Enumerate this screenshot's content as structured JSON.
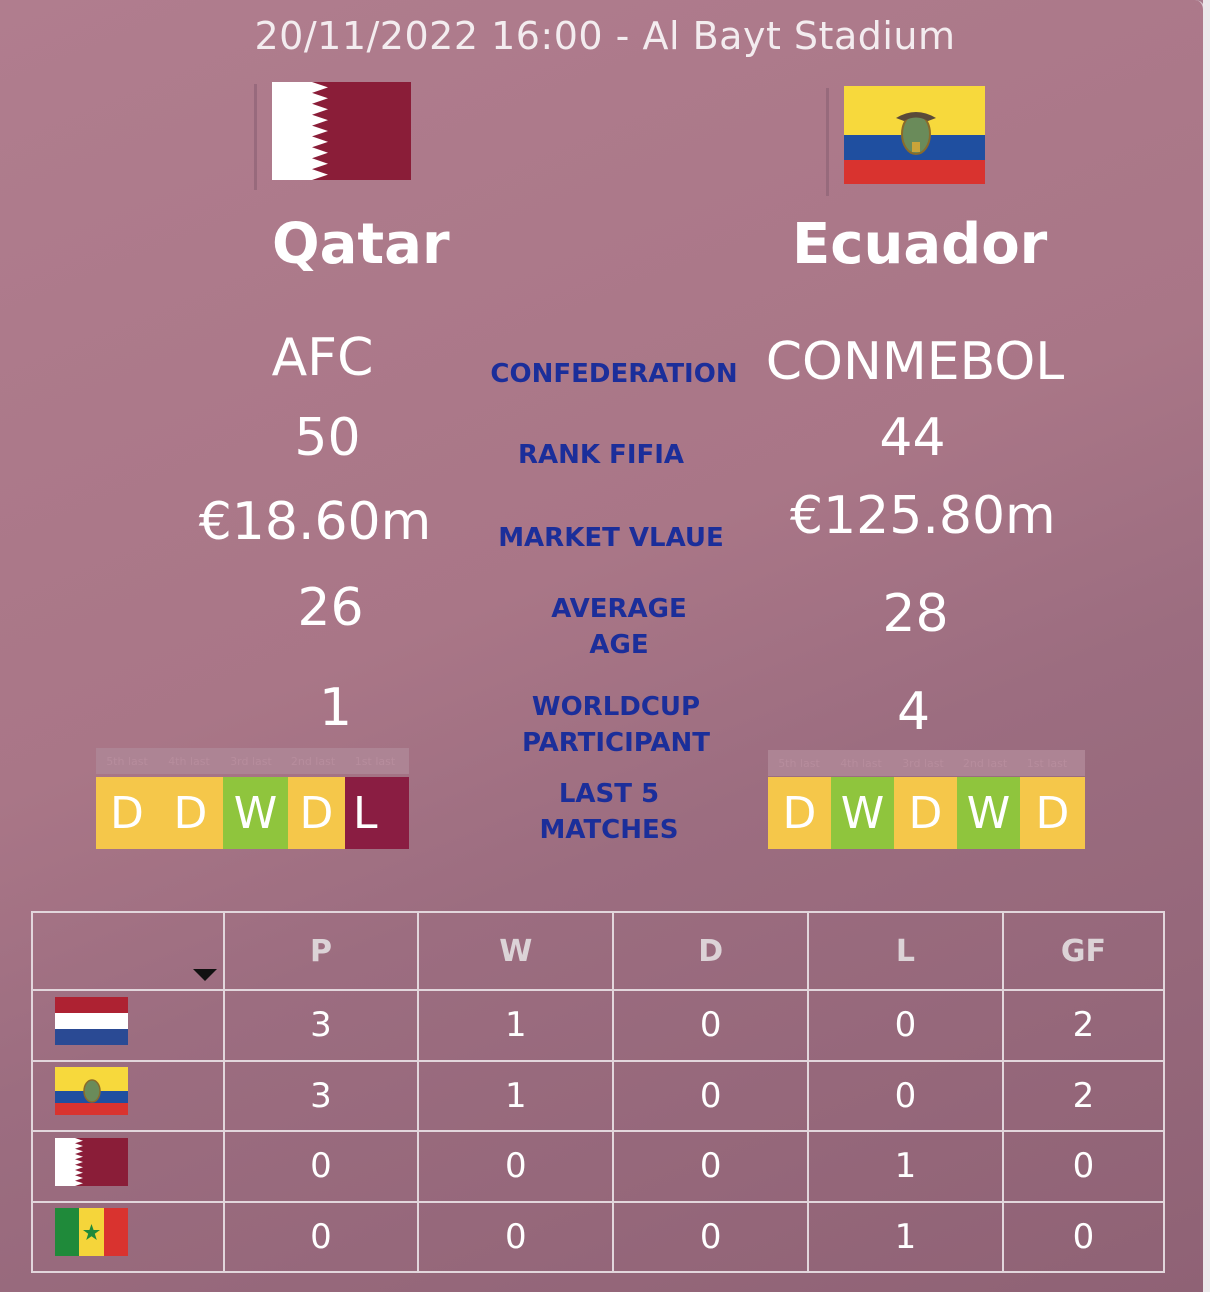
{
  "header": {
    "match_info": "20/11/2022 16:00 - Al Bayt Stadium"
  },
  "home": {
    "name": "Qatar",
    "confederation": "AFC",
    "rank": "50",
    "market_value": "€18.60m",
    "average_age": "26",
    "worldcup_participations": "1",
    "last5": [
      "D",
      "D",
      "W",
      "D",
      "L"
    ]
  },
  "away": {
    "name": "Ecuador",
    "confederation": "CONMEBOL",
    "rank": "44",
    "market_value": "€125.80m",
    "average_age": "28",
    "worldcup_participations": "4",
    "last5": [
      "D",
      "W",
      "D",
      "W",
      "D"
    ]
  },
  "labels": {
    "confederation": "CONFEDERATION",
    "rank": "RANK FIFIA",
    "market_value": "MARKET VLAUE",
    "average_age_1": "AVERAGE",
    "average_age_2": "AGE",
    "worldcup_1": "WORLDCUP",
    "worldcup_2": "PARTICIPANT",
    "last5_1": "LAST 5",
    "last5_2": "MATCHES"
  },
  "form_headers": [
    "5th last",
    "4th last",
    "3rd last",
    "2nd last",
    "1st last"
  ],
  "colors": {
    "draw": "#f5c74a",
    "win": "#8fc53d",
    "loss": "#8a1d42",
    "label_blue": "#1b2e9a"
  },
  "standings": {
    "columns": [
      "P",
      "W",
      "D",
      "L",
      "GF"
    ],
    "rows": [
      {
        "flag": "netherlands-flag-icon",
        "values": [
          "3",
          "1",
          "0",
          "0",
          "2"
        ]
      },
      {
        "flag": "ecuador-flag-icon",
        "values": [
          "3",
          "1",
          "0",
          "0",
          "2"
        ]
      },
      {
        "flag": "qatar-flag-icon",
        "values": [
          "0",
          "0",
          "0",
          "1",
          "0"
        ]
      },
      {
        "flag": "senegal-flag-icon",
        "values": [
          "0",
          "0",
          "0",
          "1",
          "0"
        ]
      }
    ]
  }
}
